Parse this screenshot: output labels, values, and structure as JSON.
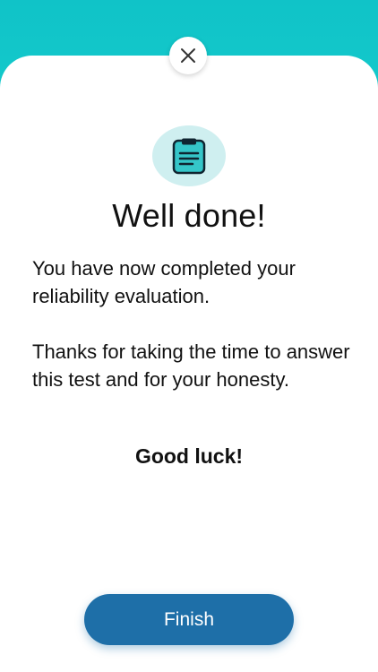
{
  "screen": {
    "title": "Well done!",
    "message_line1": "You have now completed your reliability evaluation.",
    "message_line2": "Thanks for taking the time to answer this test and for your honesty.",
    "closing": "Good luck!",
    "finish_label": "Finish"
  },
  "icons": {
    "close": "close-icon",
    "clipboard": "clipboard-icon"
  },
  "colors": {
    "header": "#12c4c9",
    "badge_bg": "#cfeff0",
    "clipboard_fill": "#35c6c9",
    "primary_button": "#1e6fa8"
  }
}
